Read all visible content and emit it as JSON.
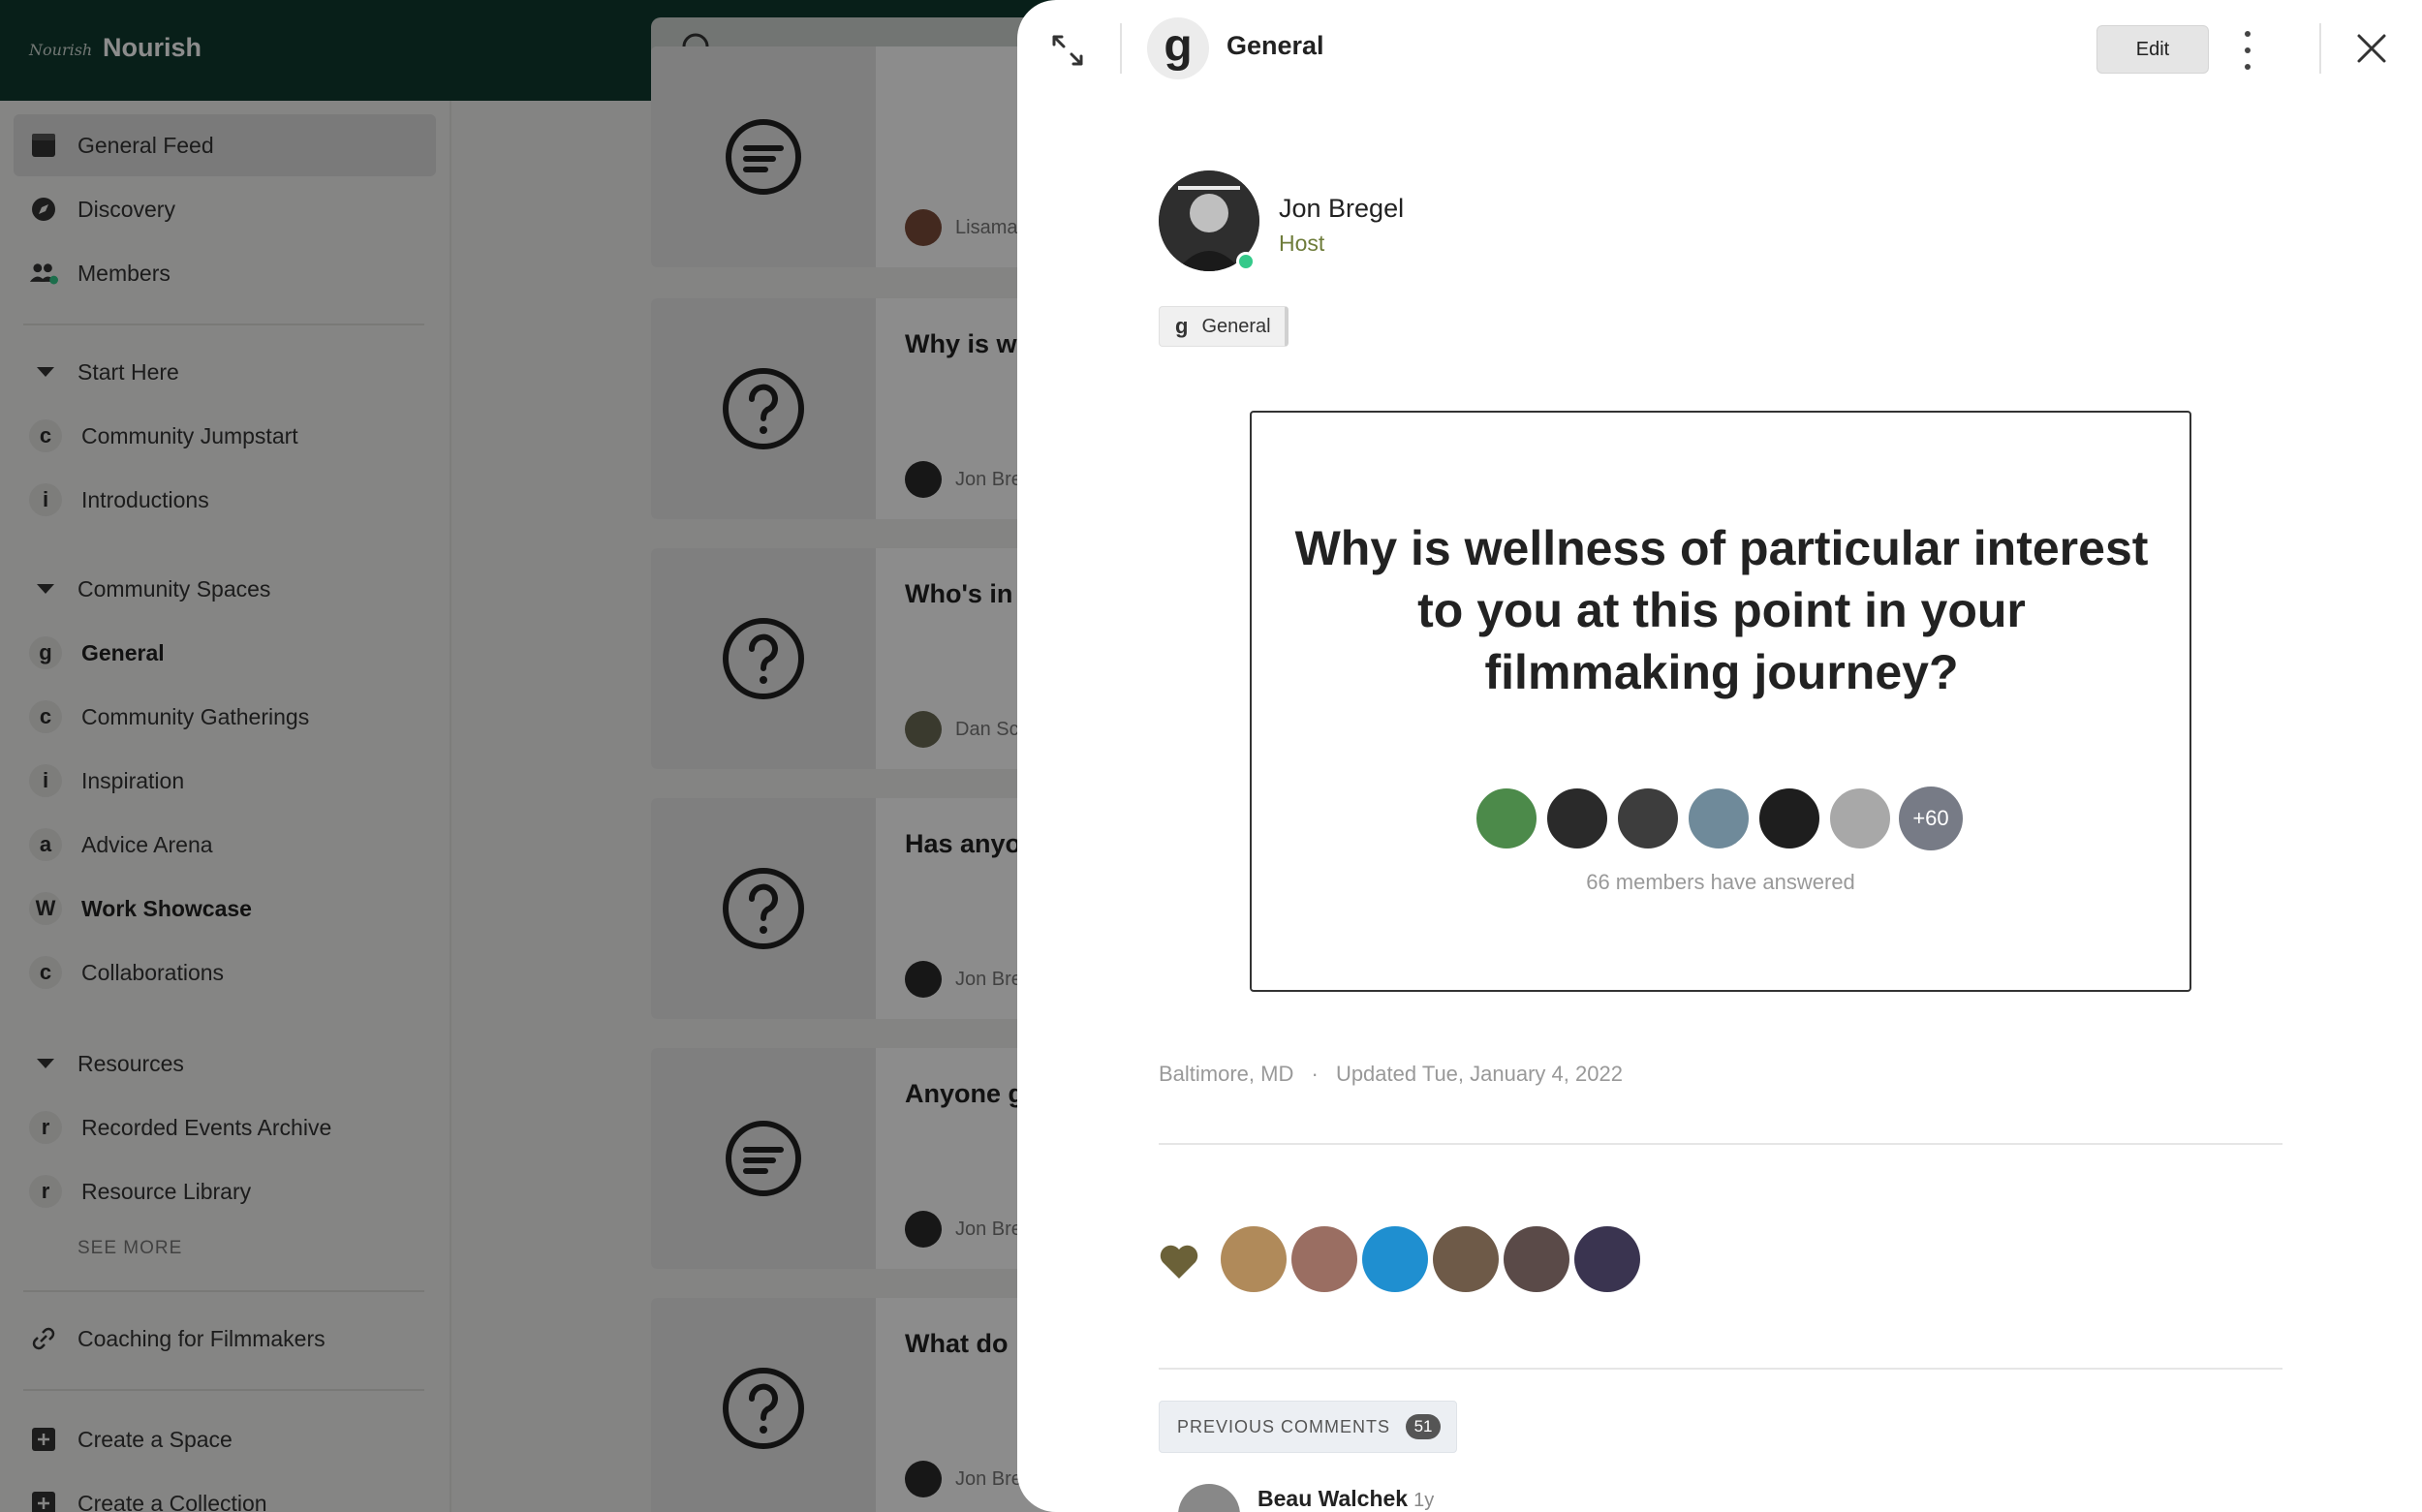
{
  "topbar": {
    "logo_script": "Nourish",
    "brand": "Nourish",
    "search_placeholder": ""
  },
  "sidebar": {
    "primary": [
      {
        "label": "General Feed",
        "icon": "feed-icon",
        "active": true
      },
      {
        "label": "Discovery",
        "icon": "compass-icon"
      },
      {
        "label": "Members",
        "icon": "members-icon"
      }
    ],
    "sections": [
      {
        "title": "Start Here",
        "items": [
          {
            "letter": "c",
            "label": "Community Jumpstart"
          },
          {
            "letter": "i",
            "label": "Introductions"
          }
        ]
      },
      {
        "title": "Community Spaces",
        "items": [
          {
            "letter": "g",
            "label": "General",
            "bold": true
          },
          {
            "letter": "c",
            "label": "Community Gatherings"
          },
          {
            "letter": "i",
            "label": "Inspiration"
          },
          {
            "letter": "a",
            "label": "Advice Arena"
          },
          {
            "letter": "W",
            "label": "Work Showcase",
            "bold": true
          },
          {
            "letter": "c",
            "label": "Collaborations"
          }
        ]
      },
      {
        "title": "Resources",
        "items": [
          {
            "letter": "r",
            "label": "Recorded Events Archive"
          },
          {
            "letter": "r",
            "label": "Resource Library"
          }
        ],
        "see_more": "SEE MORE"
      }
    ],
    "links": [
      {
        "label": "Coaching for Filmmakers",
        "icon": "link-icon"
      }
    ],
    "actions": [
      {
        "label": "Create a Space",
        "icon": "plus-square-icon"
      },
      {
        "label": "Create a Collection",
        "icon": "plus-square-icon"
      }
    ]
  },
  "feed": {
    "cards": [
      {
        "title": "",
        "author": "Lisama",
        "icon": "discussion-icon"
      },
      {
        "title": "Why is we",
        "author": "Jon Bre",
        "icon": "question-icon"
      },
      {
        "title": "Who's in",
        "author": "Dan Sc",
        "icon": "question-icon"
      },
      {
        "title": "Has anyo",
        "author": "Jon Bre",
        "icon": "question-icon"
      },
      {
        "title": "Anyone g",
        "author": "Jon Bre",
        "icon": "discussion-icon"
      },
      {
        "title": "What do",
        "author": "Jon Bre",
        "icon": "question-icon"
      }
    ]
  },
  "modal": {
    "space_letter": "g",
    "space_name": "General",
    "edit_label": "Edit",
    "author": {
      "name": "Jon Bregel",
      "role": "Host"
    },
    "tag": {
      "letter": "g",
      "label": "General"
    },
    "question": "Why is wellness of particular interest to you at this point in your filmmaking journey?",
    "answer_more": "+60",
    "answered_text": "66 members have answered",
    "location": "Baltimore, MD",
    "separator": "·",
    "updated": "Updated Tue, January 4, 2022",
    "previous_comments_label": "PREVIOUS COMMENTS",
    "previous_comments_count": "51",
    "first_comment": {
      "author": "Beau Walchek",
      "time": "1y"
    }
  },
  "colors": {
    "topbar_bg": "#0f3a2f",
    "online": "#35c98a",
    "host_role": "#6e7c3a",
    "heart": "#6b6138",
    "more_badge": "#777b86"
  }
}
